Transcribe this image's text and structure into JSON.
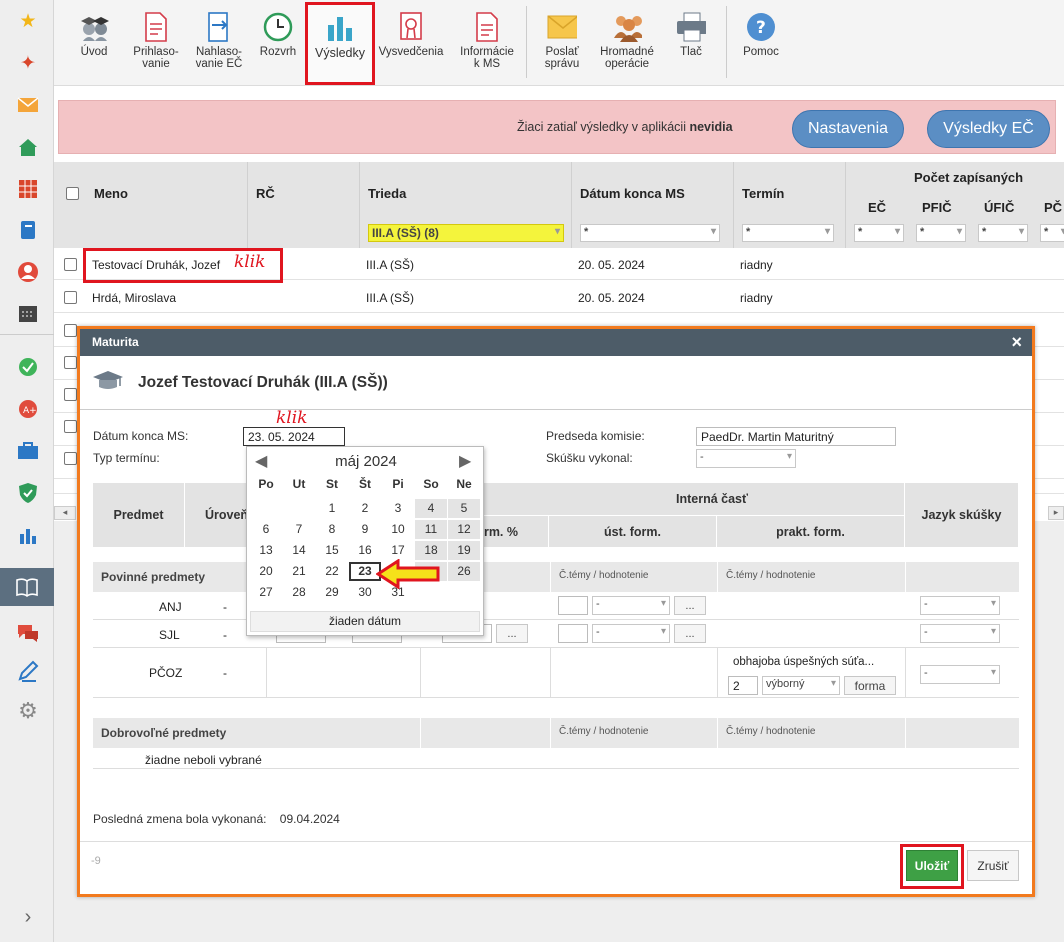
{
  "toolbar": {
    "items": [
      {
        "label": "Úvod",
        "icon": "graduates-icon"
      },
      {
        "label": "Prihlaso-\nvanie",
        "icon": "form-icon"
      },
      {
        "label": "Nahlaso-\nvanie EČ",
        "icon": "report-icon"
      },
      {
        "label": "Rozvrh",
        "icon": "clock-icon"
      },
      {
        "label": "Výsledky",
        "icon": "bar-chart-icon"
      },
      {
        "label": "Vysvedčenia",
        "icon": "certificate-icon"
      },
      {
        "label": "Informácie\nk MS",
        "icon": "info-doc-icon"
      },
      {
        "label": "Poslať\nsprávu",
        "icon": "envelope-icon"
      },
      {
        "label": "Hromadné\noperácie",
        "icon": "group-icon"
      },
      {
        "label": "Tlač",
        "icon": "printer-icon"
      },
      {
        "label": "Pomoc",
        "icon": "help-icon"
      }
    ]
  },
  "notice": {
    "text_prefix": "Žiaci zatiaľ výsledky v aplikácii ",
    "text_bold": "nevidia",
    "settings_button": "Nastavenia",
    "results_button": "Výsledky EČ"
  },
  "grid": {
    "columns": {
      "name": "Meno",
      "rc": "RČ",
      "class": "Trieda",
      "end_date": "Dátum konca MS",
      "term": "Termín",
      "count_header": "Počet zapísaných",
      "ec": "EČ",
      "pfic": "PFIČ",
      "ufic": "ÚFIČ",
      "pc": "PČ"
    },
    "filters": {
      "class": "III.A (SŠ) (8)",
      "end_date": "*",
      "term": "*",
      "ec": "*",
      "pfic": "*",
      "ufic": "*",
      "pc": "*"
    },
    "rows": [
      {
        "name": "Testovací Druhák, Jozef",
        "class": "III.A (SŠ)",
        "date": "20. 05. 2024",
        "term": "riadny"
      },
      {
        "name": "Hrdá, Miroslava",
        "class": "III.A (SŠ)",
        "date": "20. 05. 2024",
        "term": "riadny"
      }
    ],
    "klik_note": "klik"
  },
  "dialog": {
    "header": "Maturita",
    "close_icon": "×",
    "title": "Jozef Testovací Druhák (III.A (SŠ))",
    "end_date_label": "Dátum konca MS:",
    "end_date_value": "23. 05. 2024",
    "klik_note": "klik",
    "term_type_label": "Typ termínu:",
    "chair_label": "Predseda komisie:",
    "chair_value": "PaedDr. Martin Maturitný",
    "exam_label": "Skúšku vykonal:",
    "exam_value": "-",
    "table": {
      "subject": "Predmet",
      "level": "Úroveň",
      "internal": "Interná časť",
      "form_pct": "form. %",
      "oral": "úst. form.",
      "practical": "prakt. form.",
      "language": "Jazyk skúšky"
    },
    "mandatory_label": "Povinné predmety",
    "themes_label": "Č.témy / hodnotenie",
    "subjects": [
      {
        "name": "ANJ",
        "level": "-",
        "lang": "-"
      },
      {
        "name": "SJL",
        "level": "-",
        "lang": "-"
      },
      {
        "name": "PČOZ",
        "level": "-",
        "lang": "-"
      }
    ],
    "practical_text": "obhajoba úspešných súťa...",
    "practical_number": "2",
    "practical_grade": "výborný",
    "forma_button": "forma",
    "dash": "-",
    "dots": "...",
    "optional_label": "Dobrovoľné predmety",
    "none_selected": "žiadne neboli vybrané",
    "last_change_label": "Posledná zmena bola vykonaná:",
    "last_change_value": "09.04.2024",
    "footer_id": "-9",
    "save_button": "Uložiť",
    "cancel_button": "Zrušiť"
  },
  "calendar": {
    "month": "máj 2024",
    "weekdays": [
      "Po",
      "Ut",
      "St",
      "Št",
      "Pi",
      "So",
      "Ne"
    ],
    "no_date": "žiaden dátum",
    "selected": 23
  },
  "colors": {
    "accent": "#3aa5c9",
    "highlight_red": "#e0151f",
    "dialog_border": "#f27a1e",
    "save_green": "#3ea045",
    "notice_bg": "#f3c4c6",
    "pill_blue": "#5b8ec4"
  }
}
